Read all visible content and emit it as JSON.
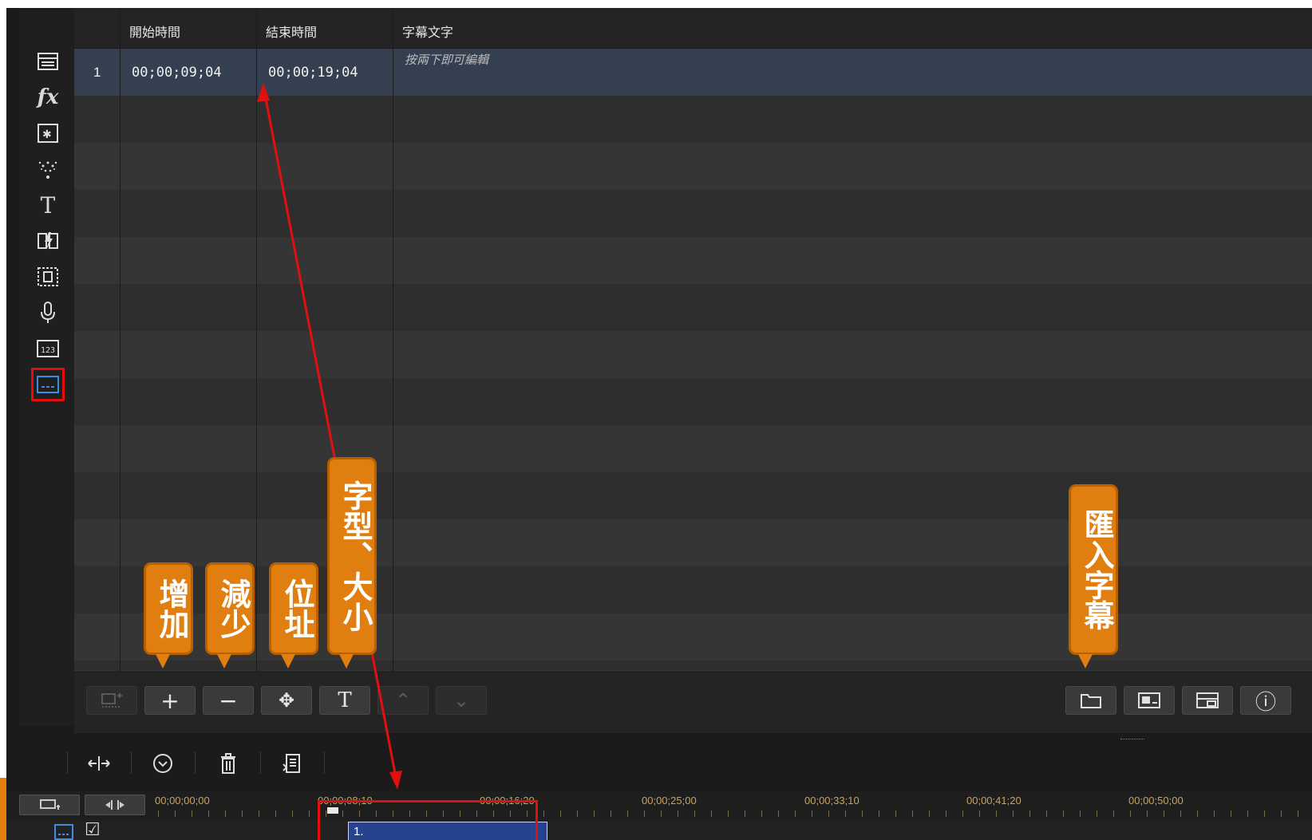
{
  "table": {
    "headers": [
      "開始時間",
      "結束時間",
      "字幕文字"
    ],
    "rows": [
      {
        "index": "1",
        "start": "00;00;09;04",
        "end": "00;00;19;04",
        "text": "按兩下即可編輯"
      }
    ]
  },
  "sidebar": {
    "items": [
      "media-room-icon",
      "fx-icon",
      "pip-object-icon",
      "particle-icon",
      "title-icon",
      "transition-icon",
      "chapter-icon",
      "voice-record-icon",
      "counter-icon",
      "subtitle-room-icon"
    ],
    "fx_glyph": "fx",
    "title_glyph": "T",
    "counter_glyph": "123"
  },
  "toolbar": {
    "add_glyph": "+",
    "remove_glyph": "−",
    "position_glyph": "✥",
    "font_glyph": "T",
    "up_glyph": "⌃",
    "down_glyph": "⌄",
    "info_glyph": "ⓘ"
  },
  "timeline": {
    "ruler_labels": [
      "00;00;00;00",
      "00;00;08;10",
      "00;00;16;20",
      "00;00;25;00",
      "00;00;33;10",
      "00;00;41;20",
      "00;00;50;00"
    ],
    "clip_label": "1.",
    "checkbox_glyph": "☑"
  },
  "annotations": {
    "add": "增加",
    "remove": "減少",
    "position": "位址",
    "font": "字型、大小",
    "import": "匯入字幕"
  },
  "colors": {
    "callout": "#e07f10",
    "highlight": "#e01010",
    "clip": "#26438f"
  }
}
